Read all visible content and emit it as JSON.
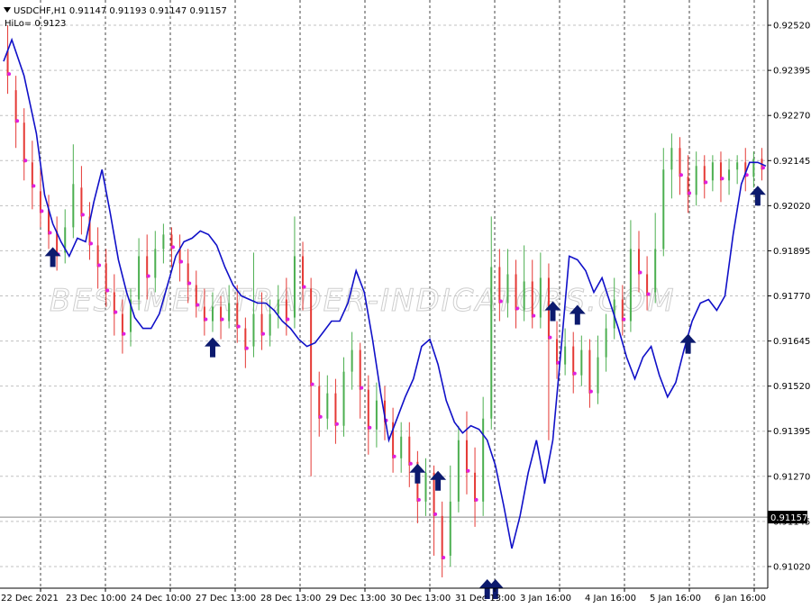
{
  "header": {
    "symbol_line": "USDCHF,H1  0.91147 0.91193 0.91147 0.91157",
    "indicator_line": "HiLo= 0.9123"
  },
  "watermark": "BEST-METATRADER-INDICATORS.COM",
  "current_price_label": "0.91157",
  "colors": {
    "background": "#ffffff",
    "grid": "#c0c0c0",
    "bull": "#4caf50",
    "bear": "#e53935",
    "hilo_line": "#1010c8",
    "arrow": "#0c1a6e",
    "dot": "#e020e0"
  },
  "chart_data": {
    "type": "line",
    "title": "",
    "xlabel": "",
    "ylabel": "",
    "ylim": [
      0.9096,
      0.9259
    ],
    "grid": true,
    "y_ticks": [
      "0.92520",
      "0.92395",
      "0.92270",
      "0.92145",
      "0.92020",
      "0.91895",
      "0.91770",
      "0.91645",
      "0.91520",
      "0.91395",
      "0.91270",
      "0.91145",
      "0.91020"
    ],
    "x_ticks": [
      "22 Dec 2021",
      "23 Dec 10:00",
      "24 Dec 10:00",
      "27 Dec 13:00",
      "28 Dec 13:00",
      "29 Dec 13:00",
      "30 Dec 13:00",
      "31 Dec 13:00",
      "3 Jan 16:00",
      "4 Jan 16:00",
      "5 Jan 16:00",
      "6 Jan 16:00"
    ],
    "series": [
      {
        "name": "HiLo",
        "points": [
          [
            0,
            0.9242
          ],
          [
            2,
            0.9248
          ],
          [
            5,
            0.9238
          ],
          [
            8,
            0.9222
          ],
          [
            10,
            0.9205
          ],
          [
            12,
            0.9197
          ],
          [
            14,
            0.9192
          ],
          [
            16,
            0.9188
          ],
          [
            18,
            0.9193
          ],
          [
            20,
            0.9192
          ],
          [
            22,
            0.9203
          ],
          [
            24,
            0.9212
          ],
          [
            26,
            0.92
          ],
          [
            28,
            0.9187
          ],
          [
            30,
            0.9178
          ],
          [
            32,
            0.9171
          ],
          [
            34,
            0.9168
          ],
          [
            36,
            0.9168
          ],
          [
            38,
            0.9172
          ],
          [
            40,
            0.918
          ],
          [
            42,
            0.9188
          ],
          [
            44,
            0.9192
          ],
          [
            46,
            0.9193
          ],
          [
            48,
            0.9195
          ],
          [
            50,
            0.9194
          ],
          [
            52,
            0.9191
          ],
          [
            54,
            0.9185
          ],
          [
            56,
            0.918
          ],
          [
            58,
            0.9177
          ],
          [
            60,
            0.9176
          ],
          [
            62,
            0.9175
          ],
          [
            64,
            0.9175
          ],
          [
            66,
            0.9173
          ],
          [
            68,
            0.917
          ],
          [
            70,
            0.9168
          ],
          [
            72,
            0.9165
          ],
          [
            74,
            0.9163
          ],
          [
            76,
            0.9164
          ],
          [
            78,
            0.9167
          ],
          [
            80,
            0.917
          ],
          [
            82,
            0.917
          ],
          [
            84,
            0.9175
          ],
          [
            86,
            0.9184
          ],
          [
            88,
            0.9178
          ],
          [
            90,
            0.9165
          ],
          [
            92,
            0.915
          ],
          [
            94,
            0.9137
          ],
          [
            96,
            0.9143
          ],
          [
            98,
            0.9149
          ],
          [
            100,
            0.9154
          ],
          [
            102,
            0.9163
          ],
          [
            104,
            0.9165
          ],
          [
            106,
            0.9158
          ],
          [
            108,
            0.9148
          ],
          [
            110,
            0.9142
          ],
          [
            112,
            0.9139
          ],
          [
            114,
            0.9141
          ],
          [
            116,
            0.914
          ],
          [
            118,
            0.9137
          ],
          [
            120,
            0.913
          ],
          [
            122,
            0.9119
          ],
          [
            124,
            0.9107
          ],
          [
            126,
            0.9116
          ],
          [
            128,
            0.9128
          ],
          [
            130,
            0.9137
          ],
          [
            132,
            0.9125
          ],
          [
            134,
            0.9137
          ],
          [
            136,
            0.9162
          ],
          [
            138,
            0.9188
          ],
          [
            140,
            0.9187
          ],
          [
            142,
            0.9184
          ],
          [
            144,
            0.9178
          ],
          [
            146,
            0.9182
          ],
          [
            148,
            0.9175
          ],
          [
            150,
            0.9168
          ],
          [
            152,
            0.916
          ],
          [
            154,
            0.9154
          ],
          [
            156,
            0.916
          ],
          [
            158,
            0.9163
          ],
          [
            160,
            0.9155
          ],
          [
            162,
            0.9149
          ],
          [
            164,
            0.9153
          ],
          [
            166,
            0.9162
          ],
          [
            168,
            0.917
          ],
          [
            170,
            0.9175
          ],
          [
            172,
            0.9176
          ],
          [
            174,
            0.9173
          ],
          [
            176,
            0.9177
          ],
          [
            178,
            0.9194
          ],
          [
            180,
            0.9208
          ],
          [
            182,
            0.9214
          ],
          [
            184,
            0.9214
          ],
          [
            186,
            0.9213
          ]
        ]
      }
    ],
    "candles": [
      {
        "i": 1,
        "o": 0.9245,
        "c": 0.9238,
        "h": 0.9252,
        "l": 0.9233
      },
      {
        "i": 3,
        "o": 0.9234,
        "c": 0.9225,
        "h": 0.9238,
        "l": 0.9218
      },
      {
        "i": 5,
        "o": 0.9225,
        "c": 0.9214,
        "h": 0.9229,
        "l": 0.9209
      },
      {
        "i": 7,
        "o": 0.9214,
        "c": 0.9207,
        "h": 0.922,
        "l": 0.9201
      },
      {
        "i": 9,
        "o": 0.9206,
        "c": 0.92,
        "h": 0.9212,
        "l": 0.9196
      },
      {
        "i": 11,
        "o": 0.9201,
        "c": 0.9194,
        "h": 0.9205,
        "l": 0.919
      },
      {
        "i": 13,
        "o": 0.9195,
        "c": 0.9188,
        "h": 0.9199,
        "l": 0.9184
      },
      {
        "i": 15,
        "o": 0.9189,
        "c": 0.9196,
        "h": 0.9201,
        "l": 0.9186
      },
      {
        "i": 17,
        "o": 0.9196,
        "c": 0.9208,
        "h": 0.9219,
        "l": 0.9193
      },
      {
        "i": 19,
        "o": 0.9207,
        "c": 0.9199,
        "h": 0.9213,
        "l": 0.9194
      },
      {
        "i": 21,
        "o": 0.9199,
        "c": 0.9191,
        "h": 0.9203,
        "l": 0.9187
      },
      {
        "i": 23,
        "o": 0.9191,
        "c": 0.9185,
        "h": 0.9196,
        "l": 0.9179
      },
      {
        "i": 25,
        "o": 0.9186,
        "c": 0.9178,
        "h": 0.919,
        "l": 0.9174
      },
      {
        "i": 27,
        "o": 0.9178,
        "c": 0.9172,
        "h": 0.9183,
        "l": 0.9166
      },
      {
        "i": 29,
        "o": 0.9172,
        "c": 0.9166,
        "h": 0.9176,
        "l": 0.9161
      },
      {
        "i": 31,
        "o": 0.9167,
        "c": 0.9176,
        "h": 0.9179,
        "l": 0.9163
      },
      {
        "i": 33,
        "o": 0.9176,
        "c": 0.9188,
        "h": 0.9193,
        "l": 0.9173
      },
      {
        "i": 35,
        "o": 0.9188,
        "c": 0.9182,
        "h": 0.9194,
        "l": 0.9176
      },
      {
        "i": 37,
        "o": 0.9182,
        "c": 0.919,
        "h": 0.9195,
        "l": 0.9178
      },
      {
        "i": 39,
        "o": 0.919,
        "c": 0.9194,
        "h": 0.9197,
        "l": 0.9186
      },
      {
        "i": 41,
        "o": 0.9194,
        "c": 0.919,
        "h": 0.9196,
        "l": 0.9185
      },
      {
        "i": 43,
        "o": 0.919,
        "c": 0.9186,
        "h": 0.9194,
        "l": 0.9181
      },
      {
        "i": 45,
        "o": 0.9186,
        "c": 0.918,
        "h": 0.919,
        "l": 0.9175
      },
      {
        "i": 47,
        "o": 0.918,
        "c": 0.9174,
        "h": 0.9184,
        "l": 0.9171
      },
      {
        "i": 49,
        "o": 0.9174,
        "c": 0.917,
        "h": 0.9179,
        "l": 0.9166
      },
      {
        "i": 51,
        "o": 0.917,
        "c": 0.9174,
        "h": 0.9178,
        "l": 0.9167
      },
      {
        "i": 53,
        "o": 0.9174,
        "c": 0.917,
        "h": 0.9177,
        "l": 0.9165
      },
      {
        "i": 55,
        "o": 0.917,
        "c": 0.9175,
        "h": 0.918,
        "l": 0.9168
      },
      {
        "i": 57,
        "o": 0.9175,
        "c": 0.9168,
        "h": 0.918,
        "l": 0.9164
      },
      {
        "i": 59,
        "o": 0.9168,
        "c": 0.9162,
        "h": 0.9171,
        "l": 0.9157
      },
      {
        "i": 61,
        "o": 0.9163,
        "c": 0.9172,
        "h": 0.9189,
        "l": 0.916
      },
      {
        "i": 63,
        "o": 0.9172,
        "c": 0.9166,
        "h": 0.9178,
        "l": 0.9162
      },
      {
        "i": 65,
        "o": 0.9166,
        "c": 0.9172,
        "h": 0.9176,
        "l": 0.9163
      },
      {
        "i": 67,
        "o": 0.9172,
        "c": 0.9176,
        "h": 0.918,
        "l": 0.9168
      },
      {
        "i": 69,
        "o": 0.9176,
        "c": 0.917,
        "h": 0.9182,
        "l": 0.9166
      },
      {
        "i": 71,
        "o": 0.9171,
        "c": 0.9188,
        "h": 0.9199,
        "l": 0.9168
      },
      {
        "i": 73,
        "o": 0.9188,
        "c": 0.9179,
        "h": 0.9192,
        "l": 0.9173
      },
      {
        "i": 75,
        "o": 0.9179,
        "c": 0.9152,
        "h": 0.9182,
        "l": 0.9127
      },
      {
        "i": 77,
        "o": 0.9152,
        "c": 0.9143,
        "h": 0.9156,
        "l": 0.9138
      },
      {
        "i": 79,
        "o": 0.9143,
        "c": 0.915,
        "h": 0.9155,
        "l": 0.914
      },
      {
        "i": 81,
        "o": 0.915,
        "c": 0.9141,
        "h": 0.9154,
        "l": 0.9136
      },
      {
        "i": 83,
        "o": 0.9141,
        "c": 0.9156,
        "h": 0.916,
        "l": 0.9138
      },
      {
        "i": 85,
        "o": 0.9156,
        "c": 0.9162,
        "h": 0.9167,
        "l": 0.9151
      },
      {
        "i": 87,
        "o": 0.9162,
        "c": 0.9151,
        "h": 0.9164,
        "l": 0.9143
      },
      {
        "i": 89,
        "o": 0.9151,
        "c": 0.914,
        "h": 0.9155,
        "l": 0.9133
      },
      {
        "i": 91,
        "o": 0.914,
        "c": 0.9148,
        "h": 0.9153,
        "l": 0.9135
      },
      {
        "i": 93,
        "o": 0.9148,
        "c": 0.9142,
        "h": 0.9152,
        "l": 0.9137
      },
      {
        "i": 95,
        "o": 0.9142,
        "c": 0.9132,
        "h": 0.9146,
        "l": 0.9128
      },
      {
        "i": 97,
        "o": 0.9132,
        "c": 0.9138,
        "h": 0.9142,
        "l": 0.9128
      },
      {
        "i": 99,
        "o": 0.9138,
        "c": 0.913,
        "h": 0.9142,
        "l": 0.9124
      },
      {
        "i": 101,
        "o": 0.9131,
        "c": 0.912,
        "h": 0.9134,
        "l": 0.9114
      },
      {
        "i": 103,
        "o": 0.912,
        "c": 0.9128,
        "h": 0.9132,
        "l": 0.9116
      },
      {
        "i": 105,
        "o": 0.9128,
        "c": 0.9116,
        "h": 0.913,
        "l": 0.9105
      },
      {
        "i": 107,
        "o": 0.9116,
        "c": 0.9104,
        "h": 0.912,
        "l": 0.9099
      },
      {
        "i": 109,
        "o": 0.9105,
        "c": 0.912,
        "h": 0.913,
        "l": 0.9102
      },
      {
        "i": 111,
        "o": 0.912,
        "c": 0.9137,
        "h": 0.9141,
        "l": 0.9117
      },
      {
        "i": 113,
        "o": 0.9137,
        "c": 0.9128,
        "h": 0.9145,
        "l": 0.9122
      },
      {
        "i": 115,
        "o": 0.9128,
        "c": 0.912,
        "h": 0.9135,
        "l": 0.9113
      },
      {
        "i": 117,
        "o": 0.912,
        "c": 0.9143,
        "h": 0.9149,
        "l": 0.9116
      },
      {
        "i": 119,
        "o": 0.9143,
        "c": 0.9185,
        "h": 0.9199,
        "l": 0.914
      },
      {
        "i": 121,
        "o": 0.9185,
        "c": 0.9175,
        "h": 0.919,
        "l": 0.917
      },
      {
        "i": 123,
        "o": 0.9175,
        "c": 0.9183,
        "h": 0.919,
        "l": 0.9171
      },
      {
        "i": 125,
        "o": 0.9183,
        "c": 0.9173,
        "h": 0.9187,
        "l": 0.9168
      },
      {
        "i": 127,
        "o": 0.9173,
        "c": 0.9181,
        "h": 0.9191,
        "l": 0.917
      },
      {
        "i": 129,
        "o": 0.9181,
        "c": 0.9171,
        "h": 0.9187,
        "l": 0.9168
      },
      {
        "i": 131,
        "o": 0.9171,
        "c": 0.9182,
        "h": 0.9189,
        "l": 0.9168
      },
      {
        "i": 133,
        "o": 0.9182,
        "c": 0.9165,
        "h": 0.9186,
        "l": 0.9137
      },
      {
        "i": 135,
        "o": 0.9165,
        "c": 0.9158,
        "h": 0.917,
        "l": 0.9154
      },
      {
        "i": 137,
        "o": 0.9158,
        "c": 0.9163,
        "h": 0.9168,
        "l": 0.9155
      },
      {
        "i": 139,
        "o": 0.9163,
        "c": 0.9155,
        "h": 0.9167,
        "l": 0.915
      },
      {
        "i": 141,
        "o": 0.9155,
        "c": 0.9162,
        "h": 0.9166,
        "l": 0.9152
      },
      {
        "i": 143,
        "o": 0.9162,
        "c": 0.915,
        "h": 0.9165,
        "l": 0.9146
      },
      {
        "i": 145,
        "o": 0.915,
        "c": 0.916,
        "h": 0.9166,
        "l": 0.9147
      },
      {
        "i": 147,
        "o": 0.916,
        "c": 0.9168,
        "h": 0.9172,
        "l": 0.9156
      },
      {
        "i": 149,
        "o": 0.9168,
        "c": 0.9176,
        "h": 0.9182,
        "l": 0.9165
      },
      {
        "i": 151,
        "o": 0.9176,
        "c": 0.917,
        "h": 0.918,
        "l": 0.9166
      },
      {
        "i": 153,
        "o": 0.917,
        "c": 0.919,
        "h": 0.9198,
        "l": 0.9167
      },
      {
        "i": 155,
        "o": 0.919,
        "c": 0.9183,
        "h": 0.9195,
        "l": 0.9178
      },
      {
        "i": 157,
        "o": 0.9183,
        "c": 0.9177,
        "h": 0.9188,
        "l": 0.9173
      },
      {
        "i": 159,
        "o": 0.9178,
        "c": 0.919,
        "h": 0.92,
        "l": 0.9175
      },
      {
        "i": 161,
        "o": 0.919,
        "c": 0.9212,
        "h": 0.9218,
        "l": 0.9188
      },
      {
        "i": 163,
        "o": 0.9212,
        "c": 0.9218,
        "h": 0.9222,
        "l": 0.9204
      },
      {
        "i": 165,
        "o": 0.9218,
        "c": 0.921,
        "h": 0.9221,
        "l": 0.9205
      },
      {
        "i": 167,
        "o": 0.921,
        "c": 0.9205,
        "h": 0.9216,
        "l": 0.92
      },
      {
        "i": 169,
        "o": 0.9205,
        "c": 0.9213,
        "h": 0.9217,
        "l": 0.9202
      },
      {
        "i": 171,
        "o": 0.9213,
        "c": 0.9208,
        "h": 0.9216,
        "l": 0.9204
      },
      {
        "i": 173,
        "o": 0.9209,
        "c": 0.9214,
        "h": 0.9216,
        "l": 0.9206
      },
      {
        "i": 175,
        "o": 0.9214,
        "c": 0.9209,
        "h": 0.9217,
        "l": 0.9203
      },
      {
        "i": 177,
        "o": 0.9209,
        "c": 0.9212,
        "h": 0.9215,
        "l": 0.9205
      },
      {
        "i": 179,
        "o": 0.9212,
        "c": 0.9214,
        "h": 0.9216,
        "l": 0.9208
      },
      {
        "i": 181,
        "o": 0.9214,
        "c": 0.921,
        "h": 0.9218,
        "l": 0.9206
      },
      {
        "i": 183,
        "o": 0.921,
        "c": 0.9215,
        "h": 0.9217,
        "l": 0.9207
      },
      {
        "i": 185,
        "o": 0.9215,
        "c": 0.9212,
        "h": 0.9218,
        "l": 0.9209
      }
    ],
    "signals": [
      {
        "i": 12,
        "p": 0.9192
      },
      {
        "i": 51,
        "p": 0.9167
      },
      {
        "i": 101,
        "p": 0.9132
      },
      {
        "i": 106,
        "p": 0.913
      },
      {
        "i": 118,
        "p": 0.91
      },
      {
        "i": 120,
        "p": 0.91
      },
      {
        "i": 134,
        "p": 0.9177
      },
      {
        "i": 140,
        "p": 0.9176
      },
      {
        "i": 167,
        "p": 0.9168
      },
      {
        "i": 184,
        "p": 0.9209
      }
    ]
  }
}
